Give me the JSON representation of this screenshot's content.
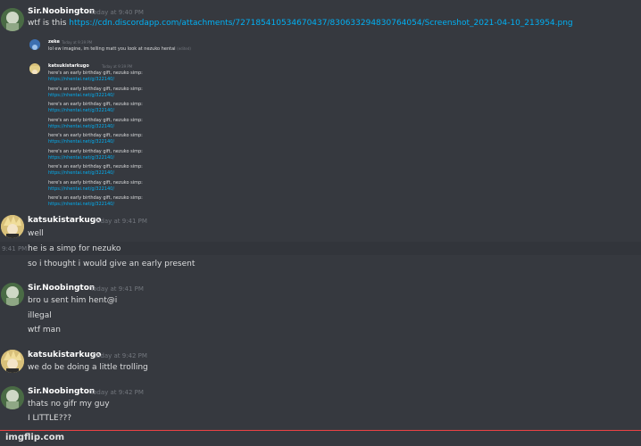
{
  "messages": [
    {
      "user": "Sir.Noobington",
      "time": "Today at 9:40 PM",
      "lines": [
        {
          "text": "wtf is this ",
          "link": "https://cdn.discordapp.com/attachments/727185410534670437/830633294830764054/Screenshot_2021-04-10_213954.png"
        }
      ]
    },
    {
      "user": "katsukistarkugo",
      "time": "Today at 9:41 PM",
      "lines": [
        "well",
        "he is a simp for nezuko",
        "so i thought i would give an early present"
      ],
      "hover_time": "9:41 PM"
    },
    {
      "user": "Sir.Noobington",
      "time": "Today at 9:41 PM",
      "lines": [
        "bro u sent him hent@i",
        "illegal",
        "wtf man"
      ]
    },
    {
      "user": "katsukistarkugo",
      "time": "Today at 9:42 PM",
      "lines": [
        "we do be doing a little trolling"
      ]
    },
    {
      "user": "Sir.Noobington",
      "time": "Today at 9:42 PM",
      "lines": [
        "thats no gifr my guy",
        "I LITTLE???"
      ]
    }
  ],
  "embed": {
    "zeke": {
      "user": "zeke",
      "time": "Today at 9:39 PM",
      "text": "lol ew imagine, im telling matt you look at nezuko hentai",
      "edited": "(edited)"
    },
    "katsu": {
      "user": "katsukistarkugo",
      "time": "Today at 9:39 PM"
    },
    "spam_text": "here's an early birthday gift, nezuko simp:",
    "spam_link": "https://nhentai.net/g/322140/",
    "spam_count": 9
  },
  "watermark": "imgflip.com"
}
